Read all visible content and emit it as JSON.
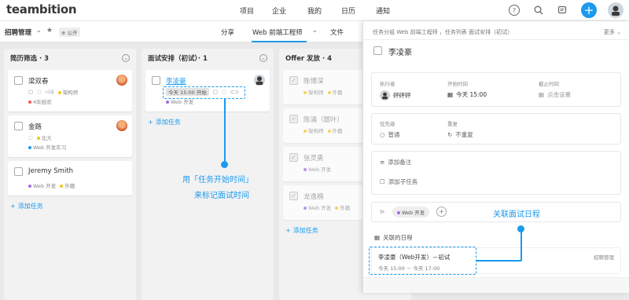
{
  "header": {
    "logo": "teambition",
    "nav": [
      "项目",
      "企业",
      "我的",
      "日历",
      "通知"
    ],
    "help": "?",
    "add": "+"
  },
  "subbar": {
    "project": "招聘管理",
    "star": "★",
    "public_badge": "公开",
    "tabs": [
      "分享",
      "Web 前端工程师",
      "文件"
    ],
    "chevron": "⌄"
  },
  "columns": [
    {
      "title": "简历筛选 · 3",
      "cards": [
        {
          "name": "梁双春",
          "meta_a": "□",
          "meta_b": "☺",
          "likes": "2",
          "tag": "架构师",
          "tag2": "4年经验"
        },
        {
          "name": "金路",
          "tag": "北大",
          "tag2": "Web 开发实习"
        },
        {
          "name": "Jeremy Smith",
          "tag": "Web 开发",
          "tag2": "外籍"
        }
      ],
      "add": "添加任务"
    },
    {
      "title": "面试安排（初试）· 1",
      "cards": [
        {
          "name": "李凌豪",
          "time": "今天 15:00 开始",
          "tag": "Web 开发"
        }
      ],
      "add": "添加任务"
    },
    {
      "title": "Offer 发放 · 4",
      "cards": [
        {
          "name": "陈博深",
          "tag": "架构师",
          "tag2": "外籍"
        },
        {
          "name": "陈涌（题叶）",
          "tag": "架构师",
          "tag2": "外籍"
        },
        {
          "name": "张灵勇",
          "tag": "Web 开发"
        },
        {
          "name": "龙逸楠",
          "tag": "Web 开发",
          "tag2": "外籍"
        }
      ],
      "add": "添加任务"
    }
  ],
  "annotations": {
    "left_line1": "用「任务开始时间」",
    "left_line2": "来标记面试时间",
    "right": "关联面试日程"
  },
  "panel": {
    "breadcrumb": "任务分组 Web 前端工程师 ，任务列表 面试安排（初试）",
    "more": "更多",
    "task_title": "李凌豪",
    "executor_label": "执行者",
    "executor": "砰砰砰",
    "start_label": "开始时间",
    "start": "今天 15:00",
    "due_label": "截止时间",
    "due": "点击设置",
    "priority_label": "优先级",
    "priority": "普通",
    "repeat_label": "重复",
    "repeat": "不重复",
    "add_note": "添加备注",
    "add_subtask": "添加子任务",
    "tag": "Web 开发",
    "related_label": "关联的日程",
    "event_title": "李凌豪（Web开发）－初试",
    "event_time": "今天 15:00 － 今天 17:00",
    "event_source": "招聘管理"
  },
  "colors": {
    "accent": "#1b9aee",
    "blue_tag": "#1b9aee",
    "purple_tag": "#a16ee0",
    "yellow_tag": "#f5c519",
    "red_tag": "#f55a4e",
    "green_tag": "#2fc25b"
  }
}
